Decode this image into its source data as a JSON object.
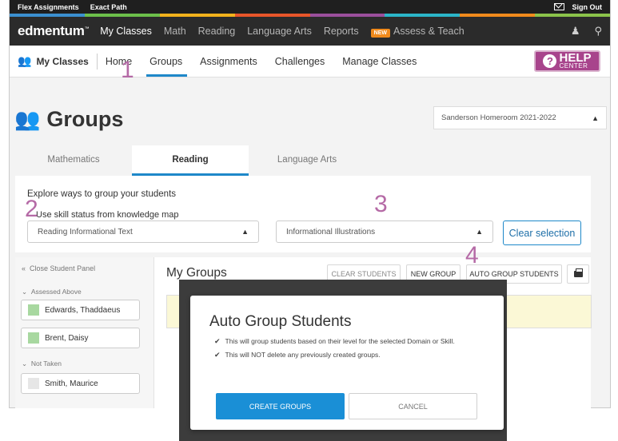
{
  "topbar": {
    "links": [
      "Flex Assignments",
      "Exact Path"
    ],
    "sign_out": "Sign Out",
    "mail_icon": "mail-icon"
  },
  "stripe_colors": [
    "#3b8fd0",
    "#6cc04a",
    "#f2b21c",
    "#e8562a",
    "#9b4f9c",
    "#2bb5c8",
    "#f08a1c",
    "#8bc34a"
  ],
  "mainnav": {
    "logo": "edmentum",
    "logo_mark": "™",
    "items": [
      "My Classes",
      "Math",
      "Reading",
      "Language Arts",
      "Reports"
    ],
    "new_badge": "NEW",
    "assess": "Assess & Teach",
    "active": "My Classes"
  },
  "subnav": {
    "section": "My Classes",
    "items": [
      "Home",
      "Groups",
      "Assignments",
      "Challenges",
      "Manage Classes"
    ],
    "active": "Groups",
    "help_line1": "HELP",
    "help_line2": "CENTER"
  },
  "page": {
    "title": "Groups",
    "class_select": "Sanderson Homeroom 2021-2022"
  },
  "subject_tabs": [
    "Mathematics",
    "Reading",
    "Language Arts"
  ],
  "active_subject": "Reading",
  "panel": {
    "explore": "Explore ways to group your students",
    "use_skill": "Use skill status from knowledge map",
    "domain_select": "Reading Informational Text",
    "skill_select": "Informational Illustrations",
    "clear_selection": "Clear selection"
  },
  "left_panel": {
    "close": "Close Student Panel",
    "groups": [
      {
        "label": "Assessed Above",
        "students": [
          {
            "name": "Edwards, Thaddaeus"
          },
          {
            "name": "Brent, Daisy"
          }
        ]
      },
      {
        "label": "Not Taken",
        "students": [
          {
            "name": "Smith, Maurice"
          }
        ]
      }
    ]
  },
  "groups_area": {
    "title": "My Groups",
    "clear_students": "CLEAR STUDENTS",
    "new_group": "NEW GROUP",
    "auto_group": "AUTO GROUP STUDENTS"
  },
  "modal": {
    "title": "Auto Group Students",
    "notes": [
      "This will group students based on their level for the selected Domain or Skill.",
      "This will NOT delete any previously created groups."
    ],
    "create": "CREATE GROUPS",
    "cancel": "CANCEL"
  },
  "annotations": [
    "1",
    "2",
    "3",
    "4"
  ],
  "colors": {
    "accent": "#1e88c9",
    "help": "#a8448c",
    "annotation": "#b56aa6",
    "new_badge": "#f08a1c",
    "assessed_above": "#a8d8a0",
    "not_taken": "#e6e6e6"
  }
}
